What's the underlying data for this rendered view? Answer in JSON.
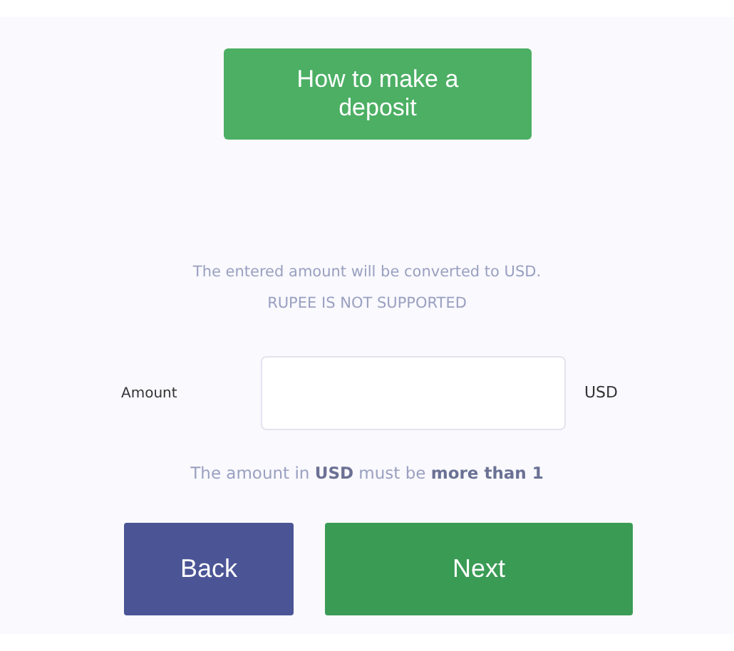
{
  "help_button": {
    "label": "How to make a deposit"
  },
  "info": [
    "The entered amount will be converted to USD.",
    "RUPEE IS NOT SUPPORTED"
  ],
  "amount": {
    "label": "Amount",
    "unit": "USD"
  },
  "hint": "The amount in **USD** must be **more than 1**",
  "buttons": [
    {
      "label": "Back",
      "kind": "secondary"
    },
    {
      "label": "Next",
      "kind": "primary"
    }
  ]
}
